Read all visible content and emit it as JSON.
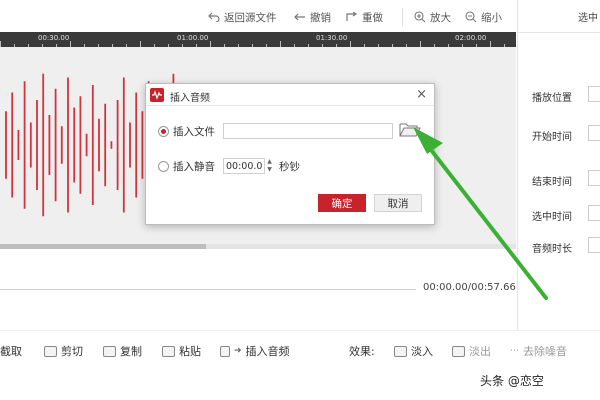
{
  "toolbar": {
    "back_to_source": "返回源文件",
    "undo": "撤销",
    "redo": "重做",
    "zoom_in": "放大",
    "zoom_out": "缩小",
    "right_cut": "选中"
  },
  "ruler": {
    "ticks": [
      "00:30.00",
      "01:00.00",
      "01:30.00",
      "02:00.00"
    ]
  },
  "waveform": {
    "color": "#d0343c",
    "scroll_fraction": 0.4
  },
  "time_readout": "00:00.00/00:57.66",
  "right_panel": {
    "labels": [
      "播放位置",
      "开始时间",
      "结束时间",
      "选中时间",
      "音频时长"
    ]
  },
  "bottom_bar": {
    "items": [
      "截取",
      "剪切",
      "复制",
      "粘贴",
      "插入音频"
    ],
    "effects_label": "效果:",
    "effects": [
      "淡入",
      "淡出",
      "去除噪音"
    ]
  },
  "dialog": {
    "title": "插入音频",
    "close": "×",
    "insert_file_label": "插入文件",
    "insert_file_value": "",
    "insert_silence_label": "插入静音",
    "silence_value": "00:00.00",
    "silence_unit": "秒钞",
    "ok": "确定",
    "cancel": "取消"
  },
  "watermark": "头条 @恋空",
  "colors": {
    "accent_red": "#c8232c",
    "arrow_green": "#3cb034"
  }
}
